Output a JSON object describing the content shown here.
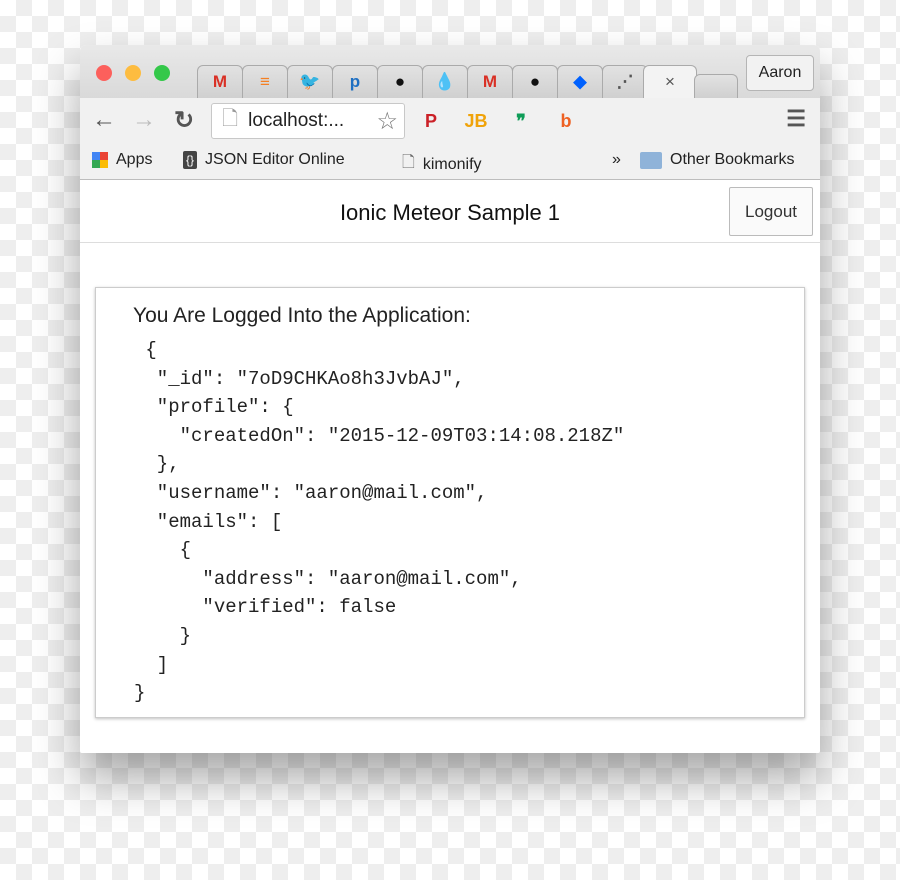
{
  "browser": {
    "tabs": [
      {
        "icon": "gmail-icon",
        "glyph": "M",
        "color": "#d93025"
      },
      {
        "icon": "stackoverflow-icon",
        "glyph": "≡",
        "color": "#f48024"
      },
      {
        "icon": "twitter-icon",
        "glyph": "🐦",
        "color": "#1da1f2"
      },
      {
        "icon": "pushbullet-icon",
        "glyph": "p",
        "color": "#1e6fc2"
      },
      {
        "icon": "github-icon",
        "glyph": "●",
        "color": "#111111"
      },
      {
        "icon": "drupal-icon",
        "glyph": "💧",
        "color": "#0678be"
      },
      {
        "icon": "gmail-icon",
        "glyph": "M",
        "color": "#d93025"
      },
      {
        "icon": "github-icon",
        "glyph": "●",
        "color": "#111111"
      },
      {
        "icon": "dropbox-icon",
        "glyph": "◆",
        "color": "#0061fe"
      },
      {
        "icon": "meteor-icon",
        "glyph": "⋰",
        "color": "#555555"
      }
    ],
    "active_tab_close": "×",
    "profile_name": "Aaron",
    "url": "localhost:...",
    "extensions": [
      {
        "icon": "pinterest-icon",
        "glyph": "P",
        "color": "#cb2027"
      },
      {
        "icon": "jetbrains-icon",
        "glyph": "JB",
        "color": "#f0a30a"
      },
      {
        "icon": "hangouts-icon",
        "glyph": "❞",
        "color": "#0f9d58"
      },
      {
        "icon": "bitly-icon",
        "glyph": "b",
        "color": "#ee6123"
      }
    ],
    "bookmarks": {
      "apps": "Apps",
      "json_editor": "JSON Editor Online",
      "kimonify": "kimonify",
      "overflow": "»",
      "other": "Other Bookmarks"
    }
  },
  "app": {
    "title": "Ionic Meteor Sample 1",
    "logout": "Logout",
    "heading": "You Are Logged Into the Application:",
    "code_lines": [
      " {",
      "  \"_id\": \"7oD9CHKAo8h3JvbAJ\",",
      "  \"profile\": {",
      "    \"createdOn\": \"2015-12-09T03:14:08.218Z\"",
      "  },",
      "  \"username\": \"aaron@mail.com\",",
      "  \"emails\": [",
      "    {",
      "      \"address\": \"aaron@mail.com\",",
      "      \"verified\": false",
      "    }",
      "  ]",
      "}"
    ]
  }
}
